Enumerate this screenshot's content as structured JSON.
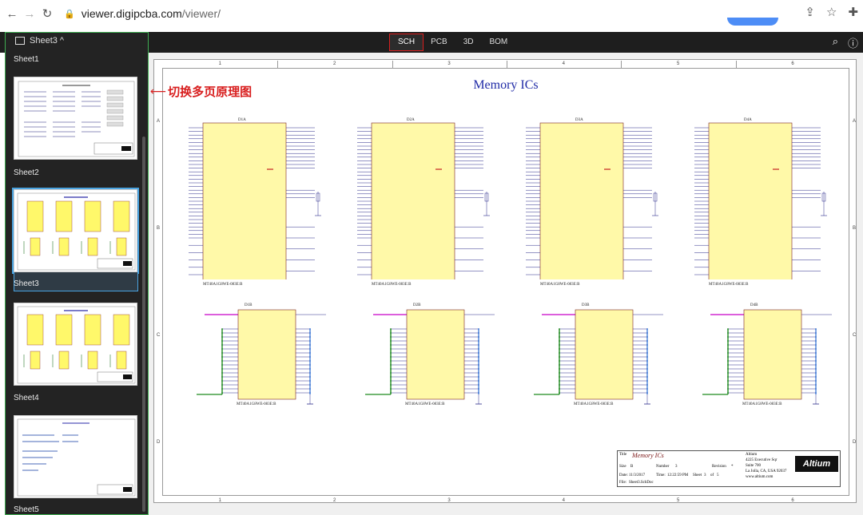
{
  "browser": {
    "url_host": "viewer.digipcba.com",
    "url_path": "/viewer/"
  },
  "appbar": {
    "sheet_toggle": "Sheet3 ^",
    "tabs": [
      {
        "label": "SCH",
        "active": true
      },
      {
        "label": "PCB",
        "active": false
      },
      {
        "label": "3D",
        "active": false
      },
      {
        "label": "BOM",
        "active": false
      }
    ]
  },
  "sidebar": {
    "sheets": [
      {
        "label": "Sheet1"
      },
      {
        "label": "Sheet2"
      },
      {
        "label": "Sheet3",
        "selected": true
      },
      {
        "label": "Sheet4"
      },
      {
        "label": "Sheet5"
      }
    ]
  },
  "annotation": {
    "text": "切换多页原理图",
    "color": "#d81e1e"
  },
  "schematic": {
    "title": "Memory ICs",
    "zones_top": [
      "1",
      "2",
      "3",
      "4",
      "5",
      "6"
    ],
    "zones_side": [
      "A",
      "B",
      "C",
      "D"
    ],
    "ics_top": [
      "D1A",
      "D2A",
      "D3A",
      "D4A"
    ],
    "ics_bottom": [
      "D1B",
      "D2B",
      "D3B",
      "D4B"
    ],
    "part": "MT40A1G8WE-083E:B",
    "titleblock": {
      "title_label": "Title",
      "title": "Memory ICs",
      "size_label": "Size",
      "size": "B",
      "number_label": "Number",
      "number": "3",
      "revision_label": "Revision",
      "revision": "*",
      "date_label": "Date:",
      "date": "11/3/2017",
      "time_label": "Time:",
      "time": "12:22:59 PM",
      "sheet_label": "Sheet",
      "sheet": "3",
      "of_label": "of",
      "of": "5",
      "file_label": "File:",
      "file": "Sheet3.SchDoc",
      "company": "Altium",
      "address1": "4225 Executive Sqr",
      "address2": "Suite 700",
      "address3": "La Jolla, CA, USA 92037",
      "website": "www.altium.com",
      "logo": "Altium"
    }
  }
}
